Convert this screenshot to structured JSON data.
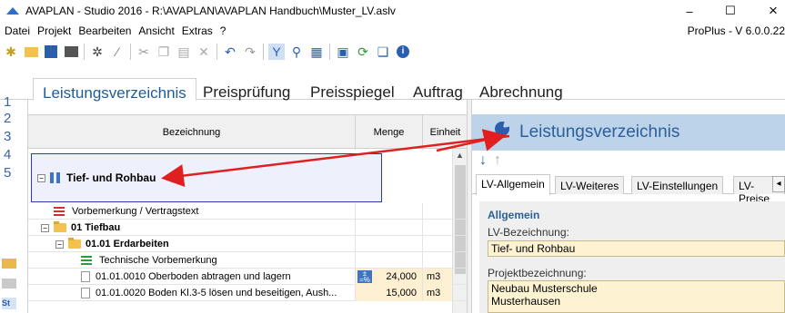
{
  "window": {
    "title": "AVAPLAN - Studio 2016 - R:\\AVAPLAN\\AVAPLAN Handbuch\\Muster_LV.aslv",
    "minimize": "–",
    "maximize": "☐",
    "close": "×"
  },
  "menu": {
    "items": [
      "Datei",
      "Projekt",
      "Bearbeiten",
      "Ansicht",
      "Extras",
      "?"
    ],
    "version": "ProPlus - V 6.0.0.22"
  },
  "toolbar": {
    "icons": [
      "new-icon",
      "open-folder-icon",
      "save-icon",
      "print-icon",
      "settings-icon",
      "magic-wand-icon",
      "cut-icon",
      "copy-icon",
      "paste-icon",
      "delete-icon",
      "undo-icon",
      "redo-icon",
      "filter-icon",
      "search-icon",
      "table-icon",
      "export-icon",
      "refresh-icon",
      "window-icon",
      "info-icon"
    ]
  },
  "tabs": [
    "Leistungsverzeichnis",
    "Preisprüfung",
    "Preisspiegel",
    "Auftrag",
    "Abrechnung"
  ],
  "levels": [
    "1",
    "2",
    "3",
    "4",
    "5"
  ],
  "grid": {
    "headers": {
      "bezeichnung": "Bezeichnung",
      "menge": "Menge",
      "einheit": "Einheit"
    },
    "selected_label": "Tief- und Rohbau",
    "rows": [
      {
        "text": "Vorbemerkung / Vertragstext",
        "menge": "",
        "einheit": ""
      },
      {
        "text": "01  Tiefbau",
        "menge": "",
        "einheit": ""
      },
      {
        "text": "01.01  Erdarbeiten",
        "menge": "",
        "einheit": ""
      },
      {
        "text": "Technische Vorbemerkung",
        "menge": "",
        "einheit": ""
      },
      {
        "text": "01.01.0010  Oberboden abtragen und lagern",
        "menge": "24,000",
        "einheit": "m3"
      },
      {
        "text": "01.01.0020  Boden Kl.3-5 lösen und beseitigen, Aush...",
        "menge": "15,000",
        "einheit": "m3"
      }
    ]
  },
  "panel": {
    "title": "Leistungsverzeichnis",
    "sub_tabs": [
      "LV-Allgemein",
      "LV-Weiteres",
      "LV-Einstellungen",
      "LV-Preise"
    ],
    "section": "Allgemein",
    "lv_bezeichnung_label": "LV-Bezeichnung:",
    "lv_bezeichnung_value": "Tief- und Rohbau",
    "projekt_label": "Projektbezeichnung:",
    "projekt_line1": "Neubau Musterschule",
    "projekt_line2": "Musterhausen"
  },
  "colors": {
    "accent": "#1c5d99",
    "panel_header": "#bcd3ea",
    "annotation_arrow": "#e02020",
    "input_bg": "#fdf3d3"
  }
}
